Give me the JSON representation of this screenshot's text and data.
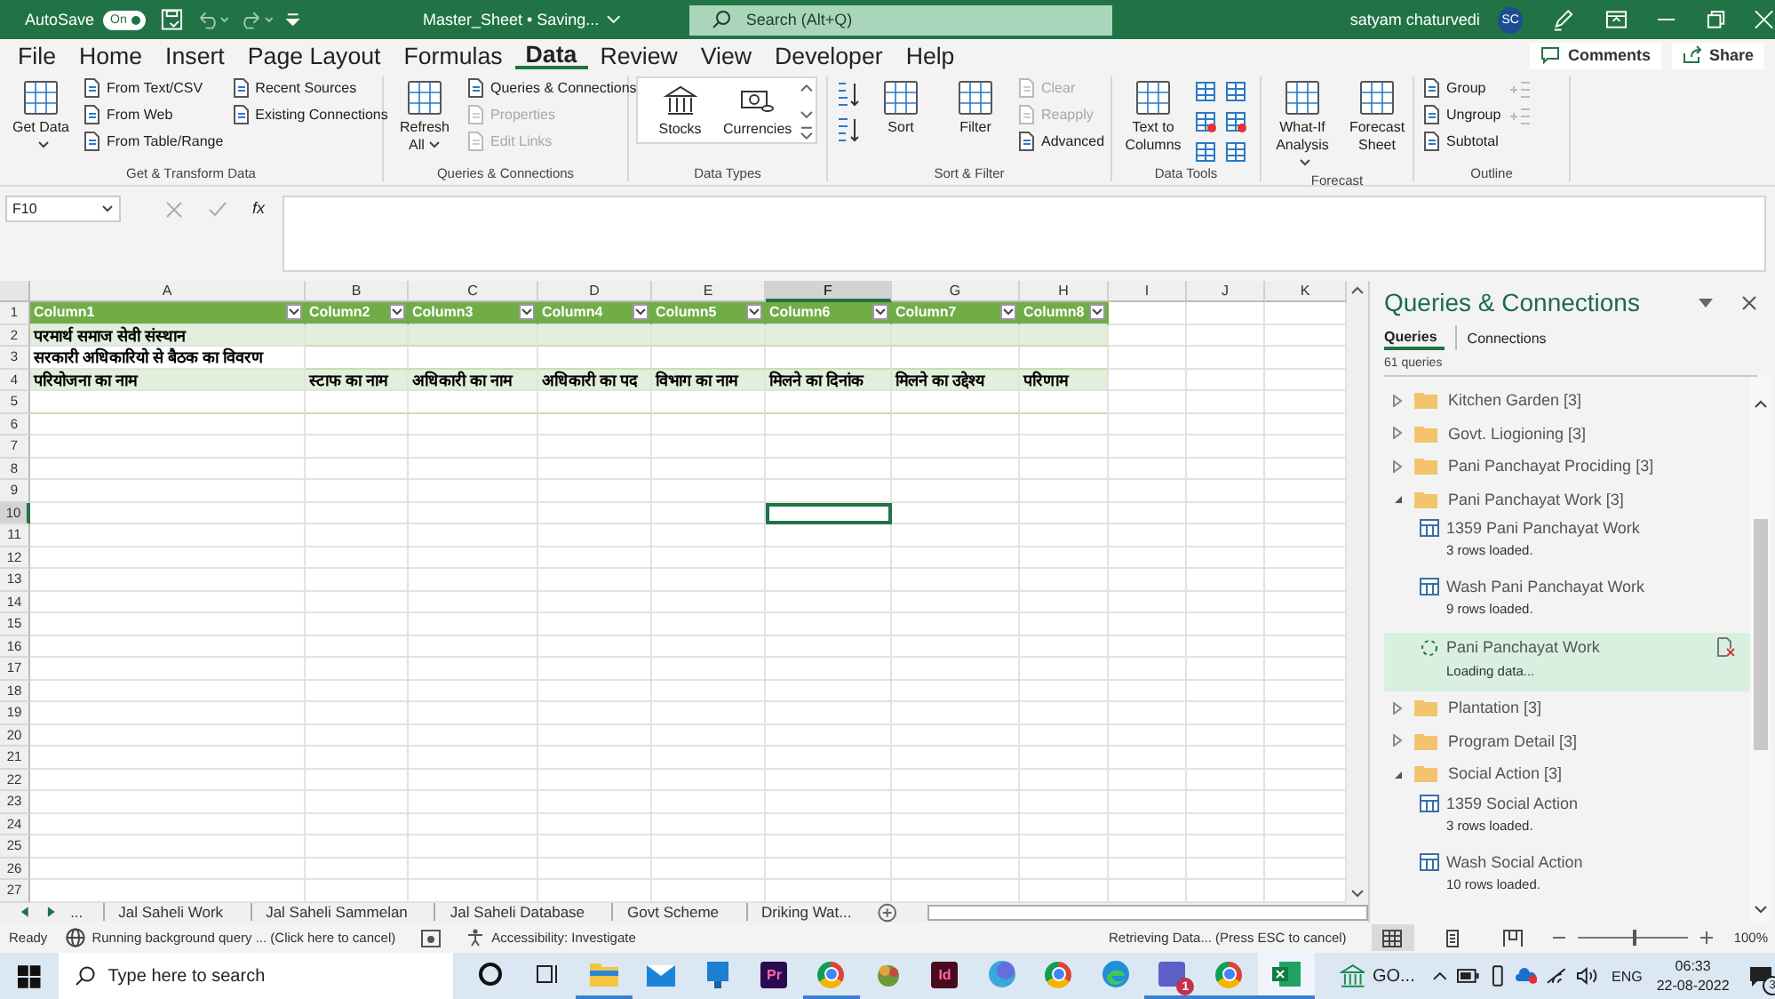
{
  "title_bar": {
    "autosave_label": "AutoSave",
    "autosave_on": true,
    "autosave_state": "On",
    "file_title": "Master_Sheet • Saving...",
    "search_placeholder": "Search (Alt+Q)",
    "user_name": "satyam chaturvedi",
    "avatar": "SC"
  },
  "menu_tabs": [
    {
      "label": "File",
      "selected": false
    },
    {
      "label": "Home",
      "selected": false
    },
    {
      "label": "Insert",
      "selected": false
    },
    {
      "label": "Page Layout",
      "selected": false
    },
    {
      "label": "Formulas",
      "selected": false
    },
    {
      "label": "Data",
      "selected": true
    },
    {
      "label": "Review",
      "selected": false
    },
    {
      "label": "View",
      "selected": false
    },
    {
      "label": "Developer",
      "selected": false
    },
    {
      "label": "Help",
      "selected": false
    }
  ],
  "header_buttons": [
    {
      "kind": "comments",
      "label": "Comments"
    },
    {
      "kind": "share",
      "label": "Share"
    }
  ],
  "ribbon_groups": [
    {
      "label": "Get & Transform Data",
      "columns": [
        {
          "kind": "large",
          "label": "Get Data",
          "dropdown": true
        },
        {
          "kind": "stack",
          "items": [
            {
              "label": "From Text/CSV",
              "disabled": false
            },
            {
              "label": "From Web",
              "disabled": false
            },
            {
              "label": "From Table/Range",
              "disabled": false
            }
          ]
        },
        {
          "kind": "stack",
          "items": [
            {
              "label": "Recent Sources",
              "disabled": false
            },
            {
              "label": "Existing Connections",
              "disabled": false
            }
          ]
        }
      ]
    },
    {
      "label": "Queries & Connections",
      "columns": [
        {
          "kind": "large",
          "label": "Refresh All",
          "dropdown": true
        },
        {
          "kind": "stack",
          "items": [
            {
              "label": "Queries & Connections",
              "disabled": false
            },
            {
              "label": "Properties",
              "disabled": true
            },
            {
              "label": "Edit Links",
              "disabled": true
            }
          ]
        }
      ]
    },
    {
      "label": "Data Types",
      "columns": [
        {
          "kind": "gallery",
          "items": [
            "Stocks",
            "Currencies"
          ]
        }
      ]
    },
    {
      "label": "Sort & Filter",
      "columns": [
        {
          "kind": "sort-icons"
        },
        {
          "kind": "large",
          "label": "Sort",
          "dropdown": false
        },
        {
          "kind": "large",
          "label": "Filter",
          "dropdown": false
        },
        {
          "kind": "stack",
          "items": [
            {
              "label": "Clear",
              "disabled": true
            },
            {
              "label": "Reapply",
              "disabled": true
            },
            {
              "label": "Advanced",
              "disabled": false
            }
          ]
        }
      ]
    },
    {
      "label": "Data Tools",
      "columns": [
        {
          "kind": "large",
          "label": "Text to Columns",
          "dropdown": false
        },
        {
          "kind": "tool-icons"
        },
        {
          "kind": "tool-icons"
        }
      ]
    },
    {
      "label": "Forecast",
      "columns": [
        {
          "kind": "large",
          "label": "What-If Analysis",
          "dropdown": true
        },
        {
          "kind": "large",
          "label": "Forecast Sheet",
          "dropdown": false
        }
      ]
    },
    {
      "label": "Outline",
      "columns": [
        {
          "kind": "stack",
          "items": [
            {
              "label": "Group",
              "disabled": false
            },
            {
              "label": "Ungroup",
              "disabled": false
            },
            {
              "label": "Subtotal",
              "disabled": false
            }
          ]
        },
        {
          "kind": "outline-icons"
        }
      ]
    }
  ],
  "formula_bar": {
    "name_box": "F10",
    "fx": "fx"
  },
  "sheet": {
    "columns": [
      {
        "letter": "A",
        "selected": false
      },
      {
        "letter": "B",
        "selected": false
      },
      {
        "letter": "C",
        "selected": false
      },
      {
        "letter": "D",
        "selected": false
      },
      {
        "letter": "E",
        "selected": false
      },
      {
        "letter": "F",
        "selected": true
      },
      {
        "letter": "G",
        "selected": false
      },
      {
        "letter": "H",
        "selected": false
      },
      {
        "letter": "I",
        "selected": false
      },
      {
        "letter": "J",
        "selected": false
      },
      {
        "letter": "K",
        "selected": false
      }
    ],
    "rows": [
      {
        "number": "1",
        "selected": false
      },
      {
        "number": "2",
        "selected": false
      },
      {
        "number": "3",
        "selected": false
      },
      {
        "number": "4",
        "selected": false
      },
      {
        "number": "5",
        "selected": false
      },
      {
        "number": "6",
        "selected": false
      },
      {
        "number": "7",
        "selected": false
      },
      {
        "number": "8",
        "selected": false
      },
      {
        "number": "9",
        "selected": false
      },
      {
        "number": "10",
        "selected": true
      },
      {
        "number": "11",
        "selected": false
      },
      {
        "number": "12",
        "selected": false
      },
      {
        "number": "13",
        "selected": false
      },
      {
        "number": "14",
        "selected": false
      },
      {
        "number": "15",
        "selected": false
      },
      {
        "number": "16",
        "selected": false
      },
      {
        "number": "17",
        "selected": false
      },
      {
        "number": "18",
        "selected": false
      },
      {
        "number": "19",
        "selected": false
      },
      {
        "number": "20",
        "selected": false
      },
      {
        "number": "21",
        "selected": false
      },
      {
        "number": "22",
        "selected": false
      },
      {
        "number": "23",
        "selected": false
      },
      {
        "number": "24",
        "selected": false
      },
      {
        "number": "25",
        "selected": false
      },
      {
        "number": "26",
        "selected": false
      },
      {
        "number": "27",
        "selected": false
      }
    ]
  },
  "table": {
    "headers": [
      "Column1",
      "Column2",
      "Column3",
      "Column4",
      "Column5",
      "Column6",
      "Column7",
      "Column8"
    ],
    "rows": [
      [
        "परमार्थ समाज सेवी संस्थान"
      ],
      [
        "सरकारी अधिकारियो से बैठक का विवरण"
      ],
      [
        "परियोजना का नाम",
        "स्टाफ का नाम",
        "अधिकारी का नाम",
        "अधिकारी का पद",
        "विभाग का नाम",
        "मिलने का दिनांक",
        "मिलने का उद्देश्य",
        "परिणाम"
      ]
    ]
  },
  "sheet_tabs": {
    "overflow": "...",
    "tabs": [
      "Jal Saheli Work",
      "Jal Saheli Sammelan",
      "Jal Saheli Database",
      "Govt Scheme",
      "Driking Wat..."
    ]
  },
  "queries_panel": {
    "title": "Queries & Connections",
    "tabs": [
      {
        "label": "Queries",
        "selected": true
      },
      {
        "label": "Connections",
        "selected": false
      }
    ],
    "count": "61 queries",
    "groups": [
      {
        "name": "Kitchen Garden [3]",
        "expanded": false
      },
      {
        "name": "Govt. Liogioning [3]",
        "expanded": false
      },
      {
        "name": "Pani Panchayat Prociding [3]",
        "expanded": false
      },
      {
        "name": "Pani Panchayat Work [3]",
        "expanded": true,
        "children": [
          {
            "name": "1359 Pani Panchayat Work",
            "status": "3 rows loaded.",
            "kind": "loaded",
            "selected": false
          },
          {
            "name": "Wash Pani Panchayat Work",
            "status": "9 rows loaded.",
            "kind": "loaded",
            "selected": false
          },
          {
            "name": "Pani Panchayat Work",
            "status": "Loading data...",
            "kind": "loading",
            "selected": true
          }
        ]
      },
      {
        "name": "Plantation [3]",
        "expanded": false
      },
      {
        "name": "Program Detail [3]",
        "expanded": false
      },
      {
        "name": "Social Action [3]",
        "expanded": true,
        "children": [
          {
            "name": "1359 Social Action",
            "status": "3 rows loaded.",
            "kind": "loaded",
            "selected": false
          },
          {
            "name": "Wash Social Action",
            "status": "10 rows loaded.",
            "kind": "loaded",
            "selected": false
          }
        ]
      }
    ]
  },
  "status_bar": {
    "ready": "Ready",
    "background_query": "Running background query ...  (Click here to cancel)",
    "accessibility": "Accessibility: Investigate",
    "retrieving": "Retrieving Data... (Press ESC to cancel)",
    "views": [
      {
        "kind": "normal",
        "selected": true
      },
      {
        "kind": "page-layout",
        "selected": false
      },
      {
        "kind": "page-break",
        "selected": false
      }
    ],
    "zoom_slider": {
      "level": 0.5
    },
    "zoom": "100%"
  },
  "taskbar": {
    "search_placeholder": "Type here to search",
    "apps": [
      {
        "kind": "cortana",
        "running": false,
        "selected": false
      },
      {
        "kind": "task-view",
        "running": false,
        "selected": false
      },
      {
        "kind": "folder",
        "running": true,
        "selected": false
      },
      {
        "kind": "mail",
        "running": false,
        "selected": false
      },
      {
        "kind": "monitor",
        "running": false,
        "selected": false
      },
      {
        "kind": "tile",
        "label": "Pr",
        "color": "#2b0a4f",
        "running": false,
        "selected": false
      },
      {
        "kind": "browser",
        "running": true,
        "selected": false
      },
      {
        "kind": "game",
        "running": false,
        "selected": false
      },
      {
        "kind": "tile",
        "label": "Id",
        "color": "#4a0a1e",
        "running": false,
        "selected": false
      },
      {
        "kind": "round",
        "running": false,
        "selected": false
      },
      {
        "kind": "browser",
        "running": false,
        "selected": false
      },
      {
        "kind": "edge",
        "running": false,
        "selected": false
      },
      {
        "kind": "teams",
        "badge": "1",
        "running": true,
        "selected": false
      },
      {
        "kind": "browser",
        "running": true,
        "selected": false
      },
      {
        "kind": "excel",
        "running": true,
        "selected": true
      }
    ],
    "tray_app": "GO...",
    "language": "ENG",
    "time": "06:33",
    "date": "22-08-2022",
    "notifications": "3"
  }
}
